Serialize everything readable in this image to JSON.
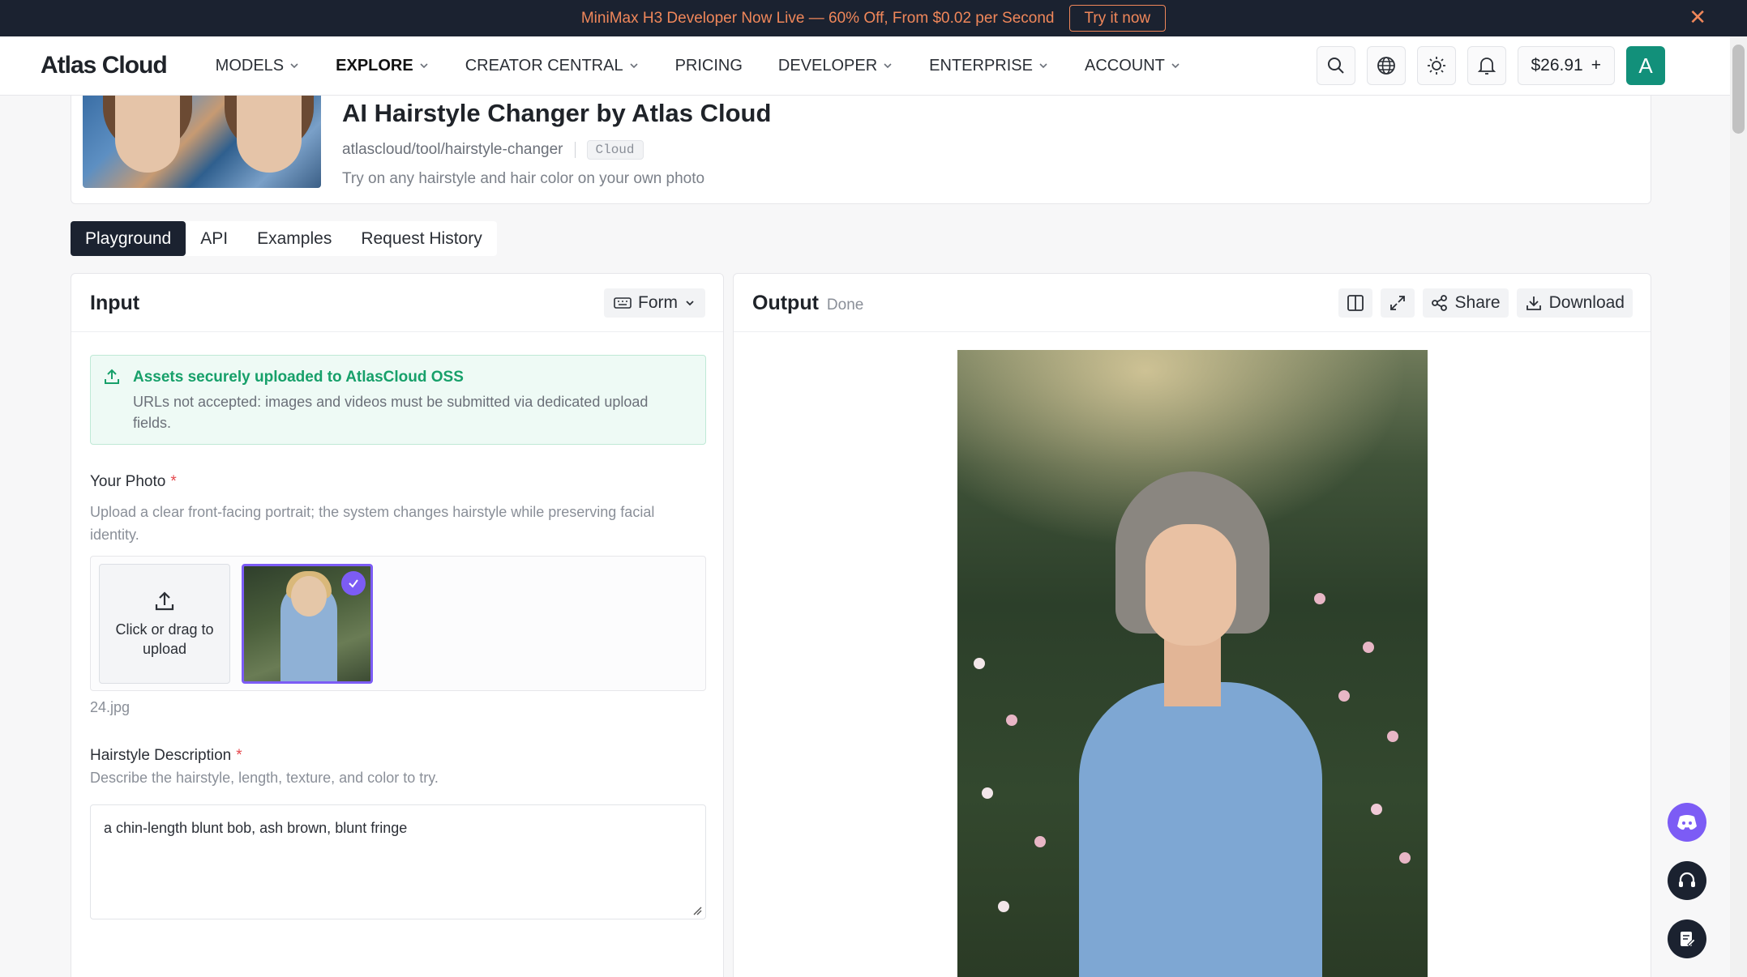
{
  "promo": {
    "text": "MiniMax H3 Developer Now Live — 60% Off, From $0.02 per Second",
    "cta": "Try it now",
    "close_icon": "close-icon"
  },
  "nav": {
    "logo": "Atlas Cloud",
    "items": [
      {
        "label": "MODELS",
        "dropdown": true
      },
      {
        "label": "EXPLORE",
        "dropdown": true,
        "active": true
      },
      {
        "label": "CREATOR CENTRAL",
        "dropdown": true
      },
      {
        "label": "PRICING",
        "dropdown": false
      },
      {
        "label": "DEVELOPER",
        "dropdown": true
      },
      {
        "label": "ENTERPRISE",
        "dropdown": true
      },
      {
        "label": "ACCOUNT",
        "dropdown": true
      }
    ],
    "balance": "$26.91",
    "balance_add": "+",
    "avatar_letter": "A",
    "icons": [
      "search-icon",
      "globe-icon",
      "sun-icon",
      "bell-icon"
    ]
  },
  "model": {
    "title": "AI Hairstyle Changer by Atlas Cloud",
    "path": "atlascloud/tool/hairstyle-changer",
    "tag": "Cloud",
    "description": "Try on any hairstyle and hair color on your own photo"
  },
  "tabs": [
    {
      "label": "Playground",
      "active": true
    },
    {
      "label": "API"
    },
    {
      "label": "Examples"
    },
    {
      "label": "Request History"
    }
  ],
  "input": {
    "title": "Input",
    "mode": "Form",
    "notice_title": "Assets securely uploaded to AtlasCloud OSS",
    "notice_text": "URLs not accepted: images and videos must be submitted via dedicated upload fields.",
    "photo_label": "Your Photo",
    "required_mark": "*",
    "photo_help": "Upload a clear front-facing portrait; the system changes hairstyle while preserving facial identity.",
    "upload_text": "Click or drag to upload",
    "file_name": "24.jpg",
    "hairstyle_label": "Hairstyle Description",
    "hairstyle_help": "Describe the hairstyle, length, texture, and color to try.",
    "hairstyle_value": "a chin-length blunt bob, ash brown, blunt fringe"
  },
  "output": {
    "title": "Output",
    "status": "Done",
    "share": "Share",
    "download": "Download"
  },
  "colors": {
    "banner_bg": "#1b2230",
    "banner_accent": "#f0875a",
    "notice_green": "#17a06a",
    "selected_purple": "#7c5cf5",
    "avatar_teal": "#12907a"
  }
}
